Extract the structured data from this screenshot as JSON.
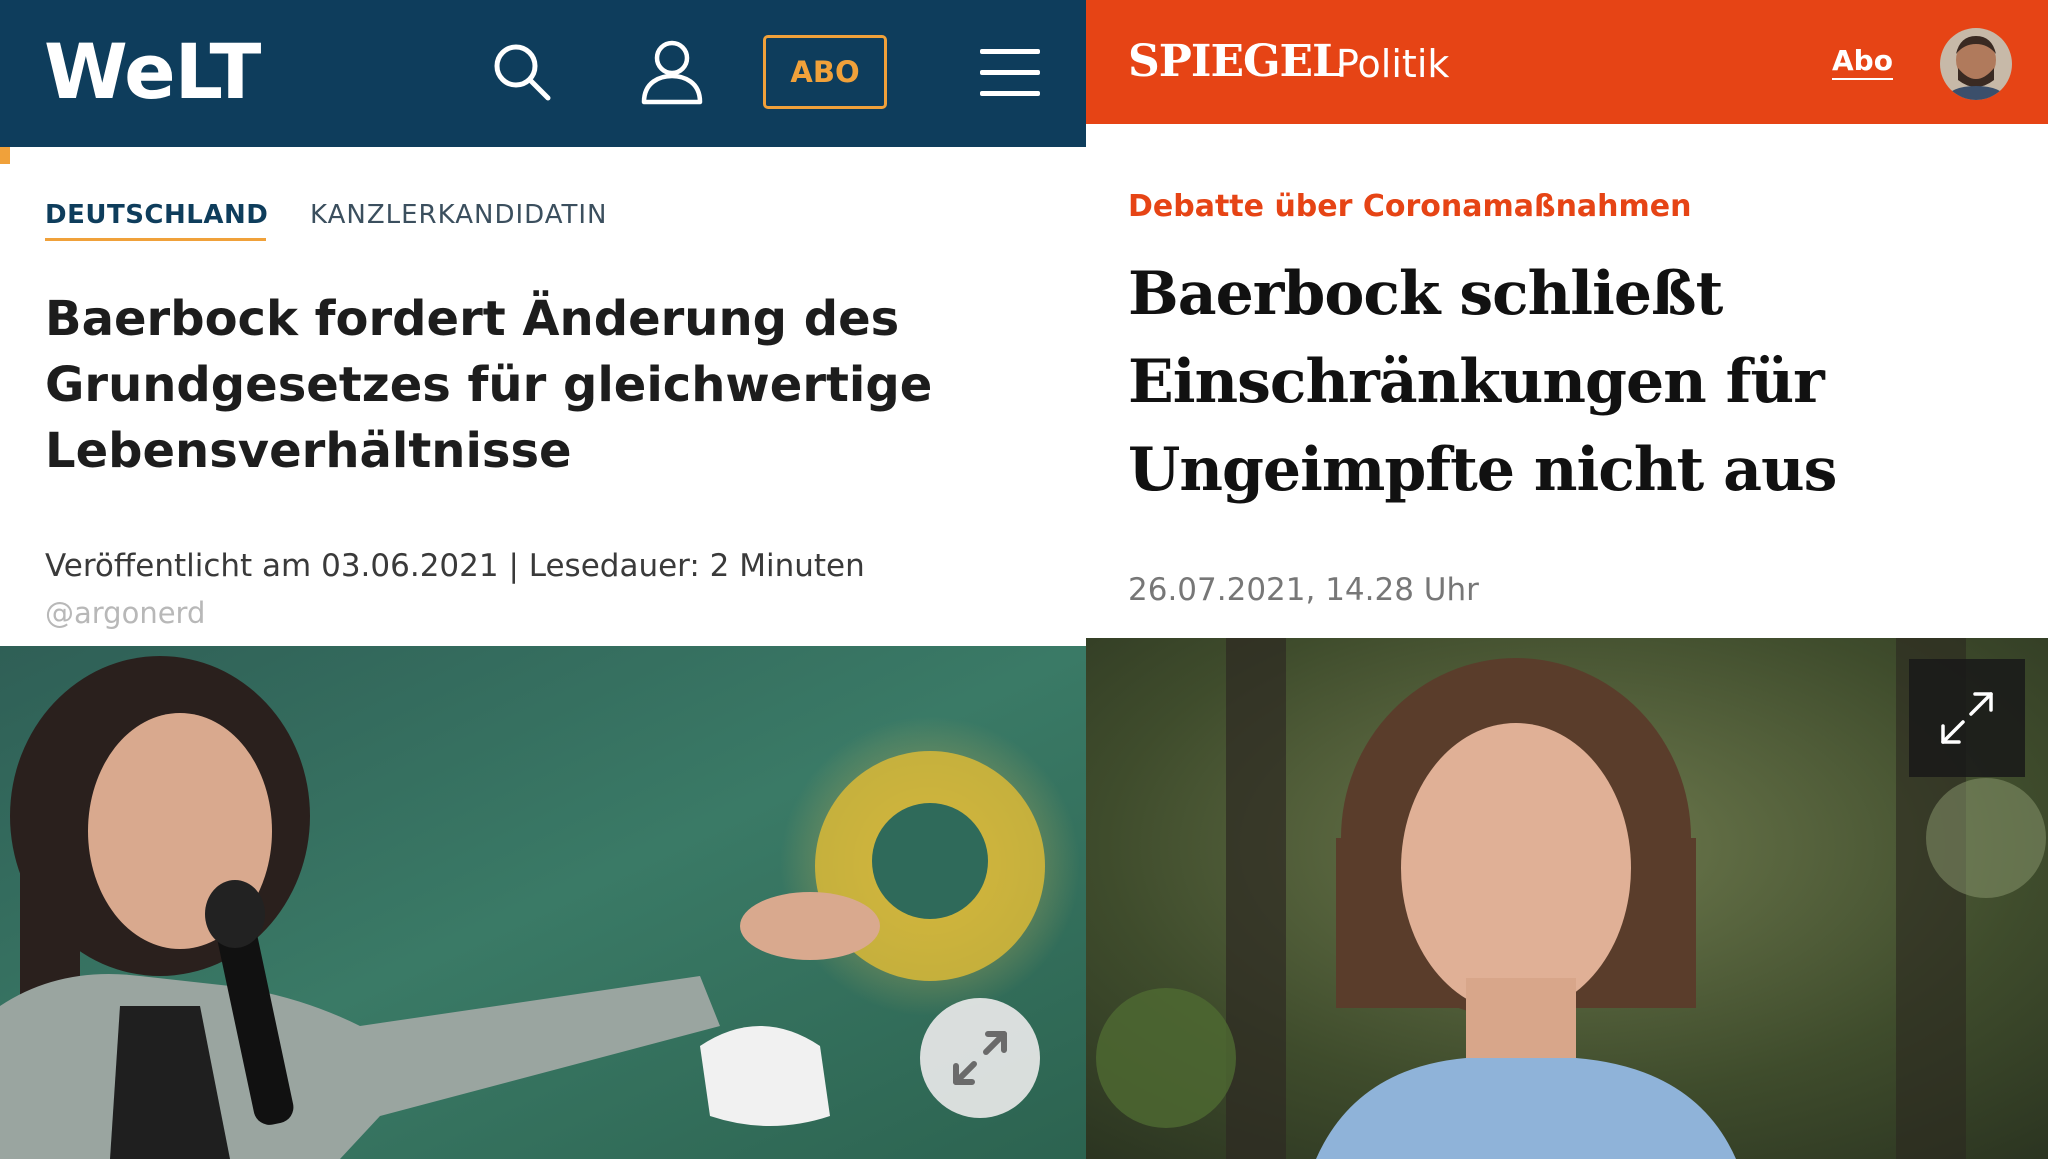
{
  "welt": {
    "logo": "WeLT",
    "abo_label": "ABO",
    "section": "DEUTSCHLAND",
    "kicker": "KANZLERKANDIDATIN",
    "headline": "Baerbock fordert Änderung des Grundgesetzes für gleichwertige Lebensverhältnisse",
    "meta": "Veröffentlicht am 03.06.2021 | Lesedauer: 2 Minuten",
    "handle": "@argonerd",
    "colors": {
      "header": "#0e3d5c",
      "accent": "#f0a13a"
    },
    "icons": [
      "search-icon",
      "user-icon",
      "menu-icon",
      "expand-icon"
    ]
  },
  "spiegel": {
    "logo": "SPIEGEL",
    "section": "Politik",
    "abo_label": "Abo",
    "kicker": "Debatte über Coronamaßnahmen",
    "headline": "Baerbock schließt Einschränkungen für Ungeimpfte nicht aus",
    "date": "26.07.2021, 14.28 Uhr",
    "colors": {
      "header": "#e64415",
      "kicker": "#e64415"
    },
    "icons": [
      "avatar",
      "expand-icon"
    ]
  }
}
